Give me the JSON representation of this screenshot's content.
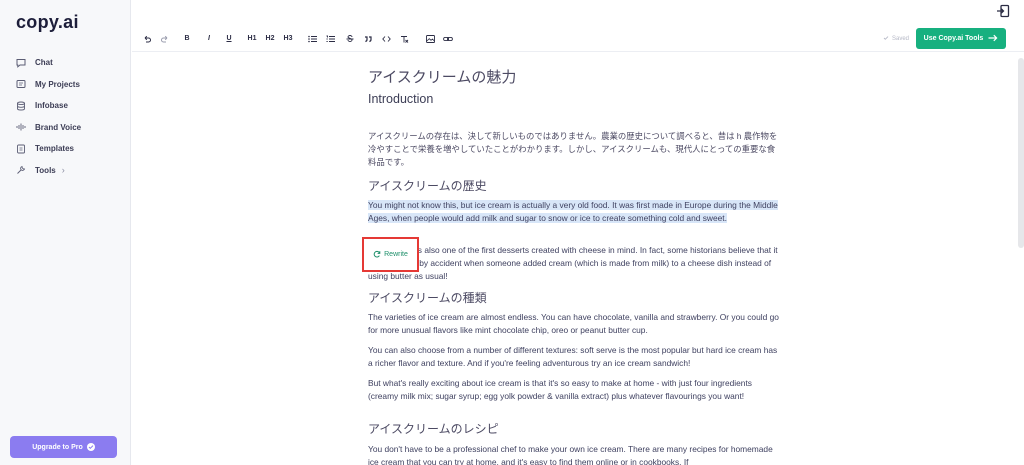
{
  "app": {
    "logo": "copy.ai"
  },
  "sidebar": {
    "items": [
      {
        "label": "Chat",
        "icon": "chat-icon"
      },
      {
        "label": "My Projects",
        "icon": "projects-icon"
      },
      {
        "label": "Infobase",
        "icon": "database-icon"
      },
      {
        "label": "Brand Voice",
        "icon": "voice-icon"
      },
      {
        "label": "Templates",
        "icon": "templates-icon"
      },
      {
        "label": "Tools",
        "icon": "tools-icon",
        "chevron": "›"
      }
    ],
    "upgrade_label": "Upgrade to Pro"
  },
  "toolbar": {
    "h1": "H1",
    "h2": "H2",
    "h3": "H3",
    "bold": "B",
    "italic": "I",
    "underline": "U",
    "saved_label": "Saved",
    "tools_button": "Use Copy.ai Tools"
  },
  "doc": {
    "title": "アイスクリームの魅力",
    "intro_heading": "Introduction",
    "intro_para": "アイスクリームの存在は、決して新しいものではありません。農業の歴史について調べると、昔は h 農作物を冷やすことで栄養を増やしていたことがわかります。しかし、アイスクリームも、現代人にとっての重要な食料品です。",
    "history_heading": "アイスクリームの歴史",
    "history_para": "You might not know this, but ice cream is actually a very old food. It was first made in Europe during the Middle Ages, when people would add milk and sugar to snow or ice to create something cold and sweet.",
    "history_para2": "Ice cream was also one of the first desserts created with cheese in mind. In fact, some historians believe that it was invented by accident when someone added cream (which is made from milk) to a cheese dish instead of using butter as usual!",
    "types_heading": "アイスクリームの種類",
    "types_para1": "The varieties of ice cream are almost endless. You can have chocolate, vanilla and strawberry. Or you could go for more unusual flavors like mint chocolate chip, oreo or peanut butter cup.",
    "types_para2": "You can also choose from a number of different textures: soft serve is the most popular but hard ice cream has a richer flavor and texture. And if you're feeling adventurous try an ice cream sandwich!",
    "types_para3": "But what's really exciting about ice cream is that it's so easy to make at home - with just four ingredients (creamy milk mix; sugar syrup; egg yolk powder & vanilla extract) plus whatever flavourings you want!",
    "recipe_heading": "アイスクリームのレシピ",
    "recipe_para": "You don't have to be a professional chef to make your own ice cream. There are many recipes for homemade ice cream that you can try at home, and it's easy to find them online or in cookbooks. If"
  },
  "rewrite": {
    "label": "Rewrite"
  },
  "colors": {
    "accent": "#17b07f",
    "upgrade": "#8b7cf0",
    "highlight": "#d8e6f8",
    "callout": "#e53935"
  }
}
